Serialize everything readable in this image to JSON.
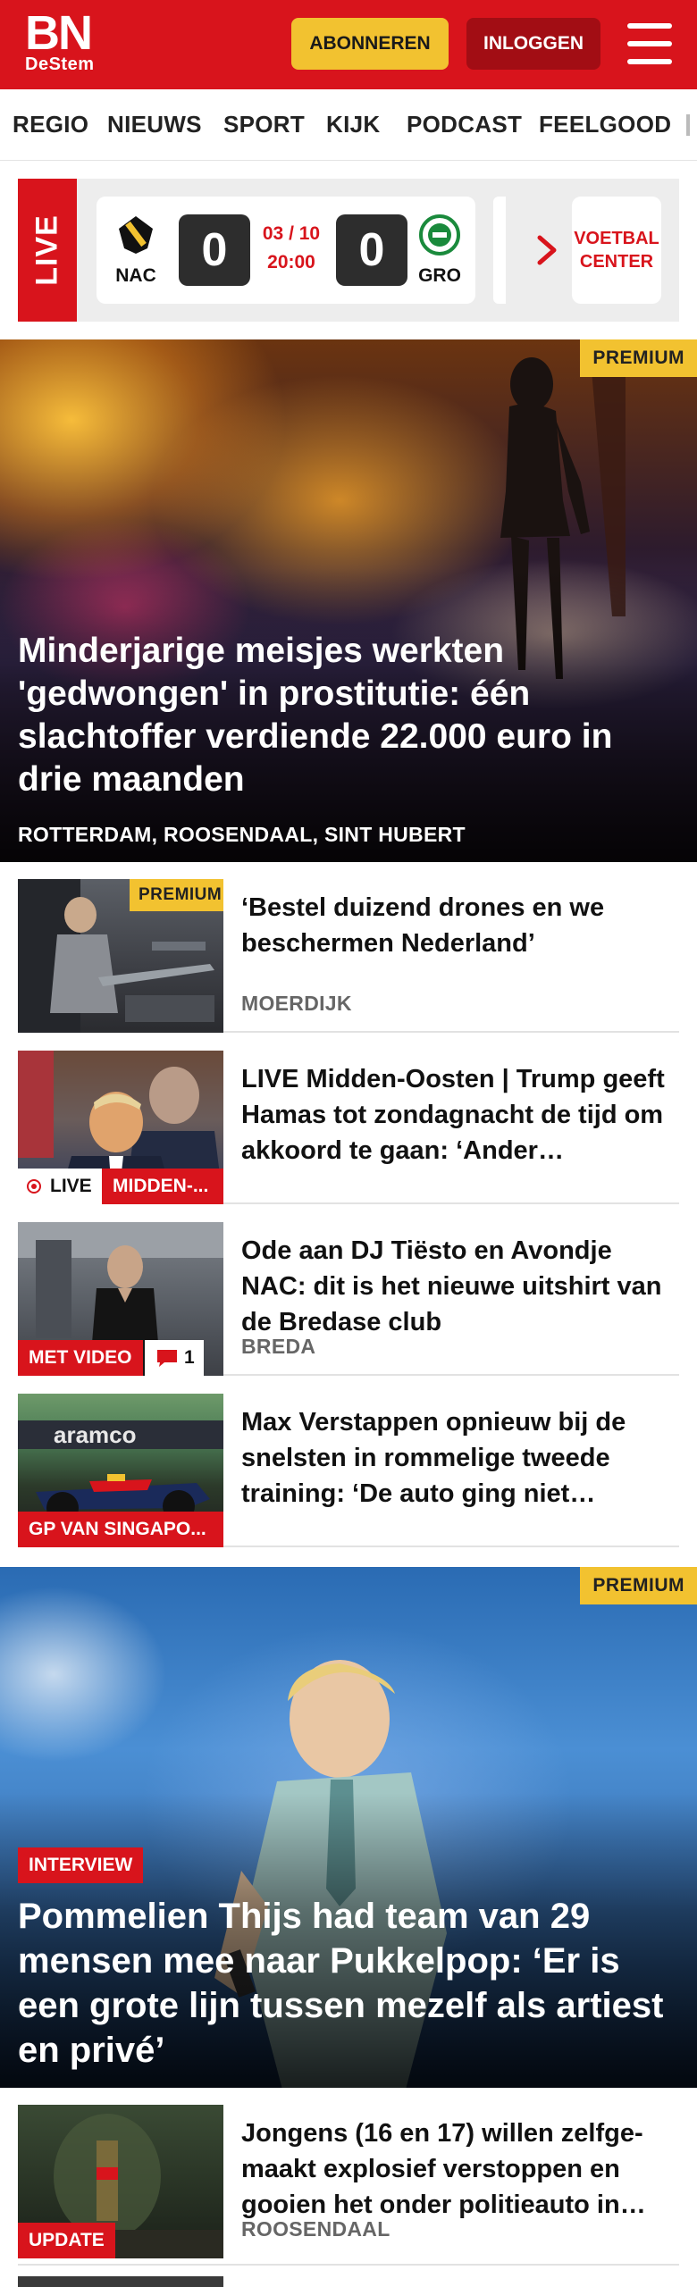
{
  "header": {
    "logo_main": "BN",
    "logo_sub": "DeStem",
    "subscribe_label": "ABONNEREN",
    "login_label": "INLOGGEN"
  },
  "nav": {
    "items": [
      "REGIO",
      "NIEUWS",
      "SPORT",
      "KIJK",
      "PODCAST",
      "FEELGOOD"
    ]
  },
  "live_bar": {
    "tag": "LIVE",
    "home_team": "NAC",
    "away_team": "GRO",
    "home_score": "0",
    "away_score": "0",
    "date": "03 / 10",
    "time": "20:00",
    "center_line1": "VOETBAL",
    "center_line2": "CENTER"
  },
  "hero1": {
    "badge": "PREMIUM",
    "title": "Minderjarige meisjes werkten 'gedwongen' in prostitutie: één slachtoffer verdiende 22.000 euro in drie maanden",
    "location": "ROTTERDAM, ROOSENDAAL, SINT HUBERT"
  },
  "articles": [
    {
      "title": "‘Bestel duizend drones en we beschermen Nederland’",
      "location": "MOERDIJK",
      "badge": "PREMIUM"
    },
    {
      "title": "LIVE Midden-Oosten | Trump geeft Hamas tot zondagnacht de tijd om akkoord te gaan: ‘Ander…",
      "live_label": "LIVE",
      "label": "MIDDEN-..."
    },
    {
      "title": "Ode aan DJ Tiësto en Avondje NAC: dit is het nieuwe uitshirt van de Bredase club",
      "location": "BREDA",
      "label": "MET VIDEO",
      "comments": "1"
    },
    {
      "title": "Max Verstappen opnieuw bij de snelsten in rommelige tweede training: ‘De auto ging niet…",
      "label": "GP VAN SINGAPO...",
      "car_text": "aramco"
    }
  ],
  "hero2": {
    "badge": "PREMIUM",
    "tag": "INTERVIEW",
    "title": "Pommelien Thijs had team van 29 mensen mee naar Pukkelpop: ‘Er is een grote lijn tussen mezelf als artiest en privé’"
  },
  "article5": {
    "title": "Jongens (16 en 17) willen zelfge­maakt explosief verstoppen en gooien het onder politieauto in…",
    "location": "ROOSENDAAL",
    "label": "UPDATE"
  },
  "colors": {
    "brand_red": "#d8141c",
    "premium_yellow": "#f2c230",
    "login_dark_red": "#a20d14"
  }
}
